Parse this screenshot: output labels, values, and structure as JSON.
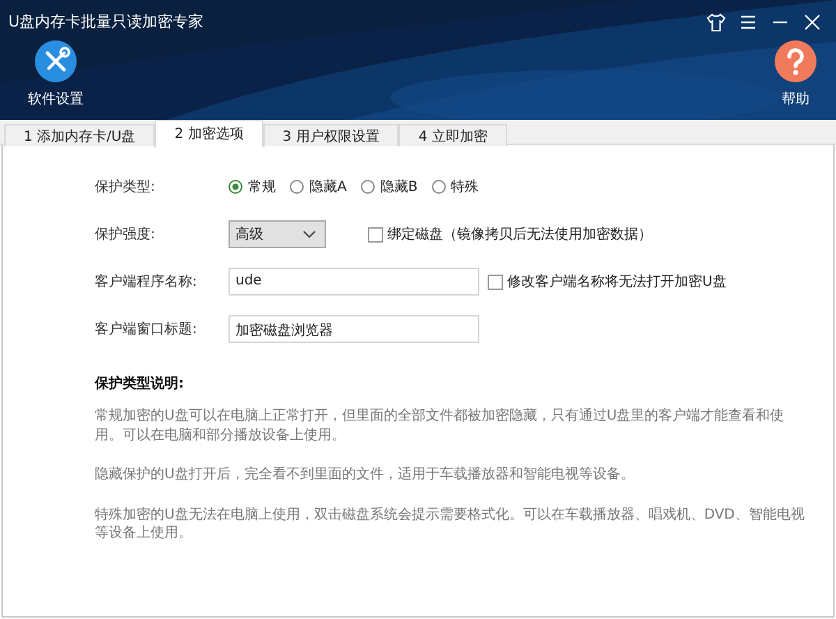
{
  "window": {
    "title": "U盘内存卡批量只读加密专家"
  },
  "toolbar": [
    {
      "kind": "settings",
      "label": "软件设置"
    },
    {
      "kind": "help",
      "label": "帮助"
    }
  ],
  "tabs": [
    {
      "label": "1 添加内存卡/U盘",
      "selected": false
    },
    {
      "label": "2 加密选项",
      "selected": true
    },
    {
      "label": "3 用户权限设置",
      "selected": false
    },
    {
      "label": "4 立即加密",
      "selected": false
    }
  ],
  "form": {
    "protection_type": {
      "label": "保护类型:",
      "options": [
        {
          "label": "常规",
          "selected": true
        },
        {
          "label": "隐藏A",
          "selected": false
        },
        {
          "label": "隐藏B",
          "selected": false
        },
        {
          "label": "特殊",
          "selected": false
        }
      ]
    },
    "strength": {
      "label": "保护强度:",
      "value": "高级",
      "checkbox": {
        "label": "绑定磁盘（镜像拷贝后无法使用加密数据）",
        "checked": false
      }
    },
    "client_name": {
      "label": "客户端程序名称:",
      "value": "ude",
      "checkbox": {
        "label": "修改客户端名称将无法打开加密U盘",
        "checked": false
      }
    },
    "window_title": {
      "label": "客户端窗口标题:",
      "value": "加密磁盘浏览器"
    }
  },
  "description": {
    "heading": "保护类型说明:",
    "paragraphs": [
      "常规加密的U盘可以在电脑上正常打开，但里面的全部文件都被加密隐藏，只有通过U盘里的客户端才能查看和使用。可以在电脑和部分播放设备上使用。",
      "隐藏保护的U盘打开后，完全看不到里面的文件，适用于车载播放器和智能电视等设备。",
      "特殊加密的U盘无法在电脑上使用，双击磁盘系统会提示需要格式化。可以在车载播放器、唱戏机、DVD、智能电视等设备上使用。"
    ]
  }
}
